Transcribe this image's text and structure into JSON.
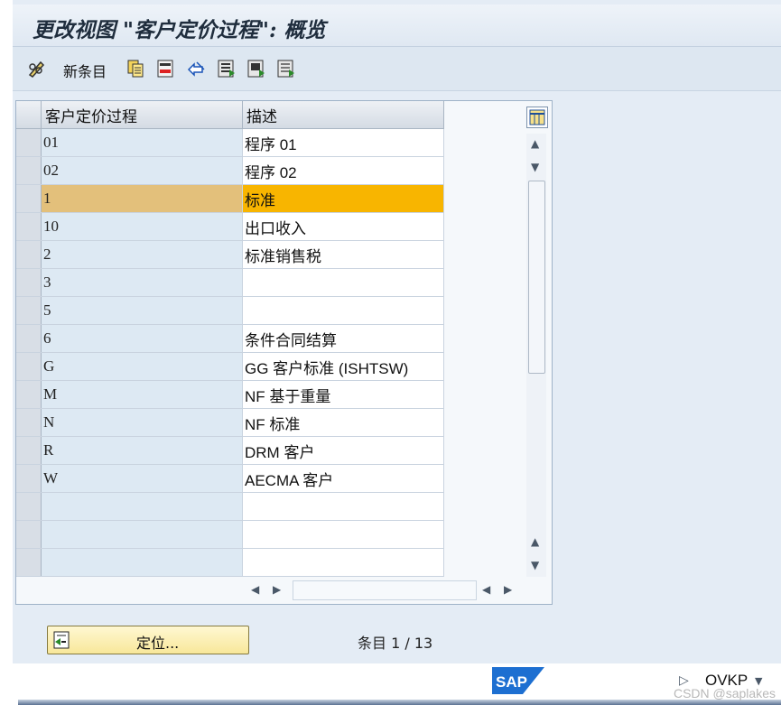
{
  "window": {
    "title": "更改视图 \"客户定价过程\": 概览"
  },
  "toolbar": {
    "new_entries_label": "新条目",
    "icons": [
      "edit-glasses-icon",
      "copy-icon",
      "delete-icon",
      "undo-icon",
      "select-all-icon",
      "select-block-icon",
      "deselect-all-icon"
    ]
  },
  "table": {
    "headers": {
      "col1": "客户定价过程",
      "col2": "描述"
    },
    "rows": [
      {
        "code": "01",
        "desc": "程序 01"
      },
      {
        "code": "02",
        "desc": "程序 02"
      },
      {
        "code": "1",
        "desc": "标准"
      },
      {
        "code": "10",
        "desc": "出口收入"
      },
      {
        "code": "2",
        "desc": "标准销售税"
      },
      {
        "code": "3",
        "desc": ""
      },
      {
        "code": "5",
        "desc": ""
      },
      {
        "code": "6",
        "desc": "条件合同结算"
      },
      {
        "code": "G",
        "desc": "GG 客户标准 (ISHTSW)"
      },
      {
        "code": "M",
        "desc": "NF 基于重量"
      },
      {
        "code": "N",
        "desc": "NF 标准"
      },
      {
        "code": "R",
        "desc": "DRM 客户"
      },
      {
        "code": "W",
        "desc": "AECMA 客户"
      }
    ],
    "highlight_color": "#f8b500"
  },
  "footer": {
    "position_button_label": "定位...",
    "entry_label": "条目 1 / 13"
  },
  "statusbar": {
    "brand": "SAP",
    "transaction": "OVKP",
    "watermark": "CSDN @saplakes"
  }
}
